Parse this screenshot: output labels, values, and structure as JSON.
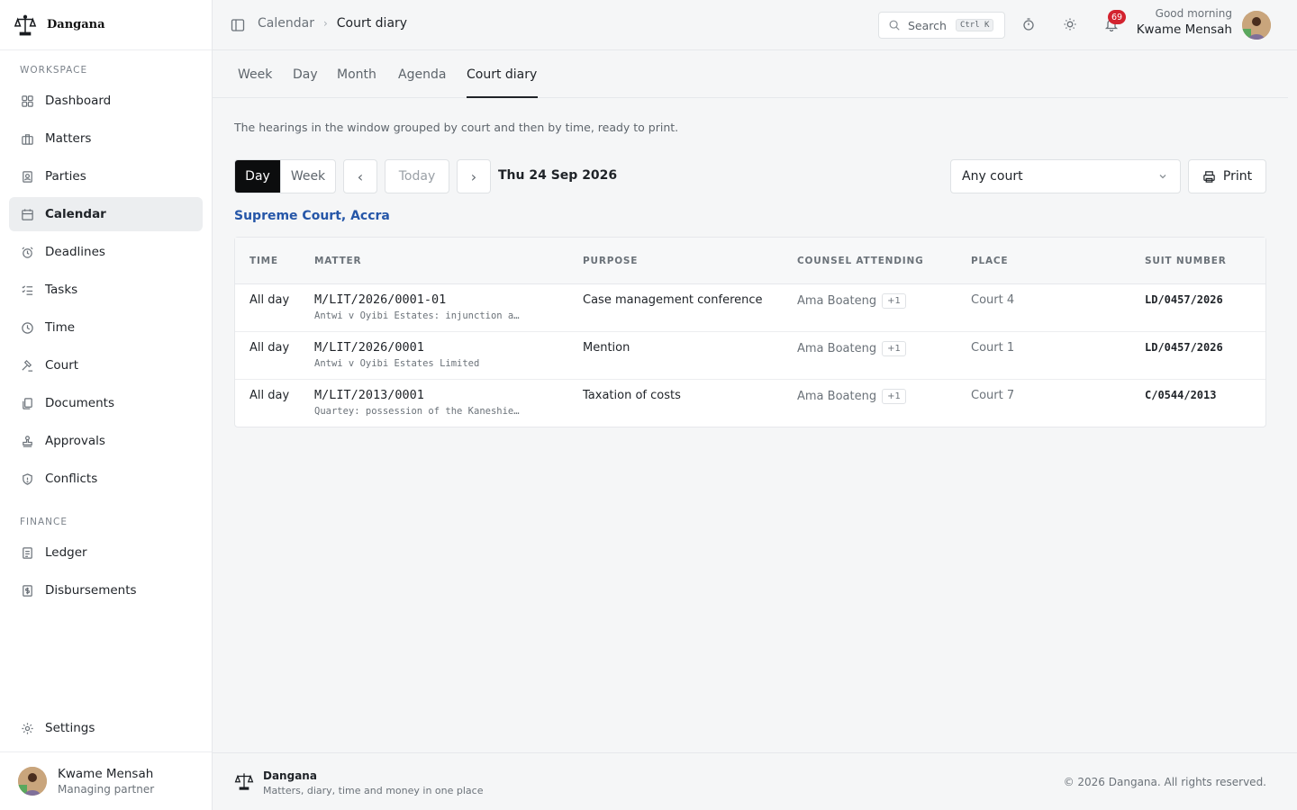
{
  "app": {
    "name": "Dangana",
    "tagline": "Matters, diary, time and money in one place",
    "copyright": "© 2026 Dangana. All rights reserved."
  },
  "sidebar": {
    "sections": [
      {
        "label": "WORKSPACE"
      },
      {
        "label": "FINANCE"
      }
    ],
    "items": [
      {
        "label": "Dashboard",
        "icon": "dashboard-icon"
      },
      {
        "label": "Matters",
        "icon": "briefcase-icon"
      },
      {
        "label": "Parties",
        "icon": "contact-card-icon"
      },
      {
        "label": "Calendar",
        "icon": "calendar-icon"
      },
      {
        "label": "Deadlines",
        "icon": "alarm-clock-icon"
      },
      {
        "label": "Tasks",
        "icon": "task-list-icon"
      },
      {
        "label": "Time",
        "icon": "clock-icon"
      },
      {
        "label": "Court",
        "icon": "gavel-icon"
      },
      {
        "label": "Documents",
        "icon": "documents-icon"
      },
      {
        "label": "Approvals",
        "icon": "stamp-icon"
      },
      {
        "label": "Conflicts",
        "icon": "shield-icon"
      },
      {
        "label": "Ledger",
        "icon": "ledger-icon"
      },
      {
        "label": "Disbursements",
        "icon": "receipt-icon"
      }
    ],
    "settings_label": "Settings",
    "active": "Calendar",
    "user": {
      "name": "Kwame Mensah",
      "role": "Managing partner"
    }
  },
  "topbar": {
    "breadcrumb": [
      "Calendar",
      "Court diary"
    ],
    "search_label": "Search",
    "search_kbd": "Ctrl K",
    "notifications": "69",
    "greeting": "Good morning",
    "user_name": "Kwame Mensah"
  },
  "tabs": [
    "Week",
    "Day",
    "Month",
    "Agenda",
    "Court diary"
  ],
  "active_tab": "Court diary",
  "description": "The hearings in the window grouped by court and then by time, ready to print.",
  "controls": {
    "range": [
      "Day",
      "Week"
    ],
    "active_range": "Day",
    "prev": "‹",
    "today": "Today",
    "next": "›",
    "date": "Thu 24 Sep 2026",
    "court_select": "Any court",
    "print": "Print"
  },
  "court_group": "Supreme Court, Accra",
  "table": {
    "headers": [
      "TIME",
      "MATTER",
      "PURPOSE",
      "COUNSEL ATTENDING",
      "PLACE",
      "SUIT NUMBER"
    ],
    "rows": [
      {
        "time": "All day",
        "code": "M/LIT/2026/0001-01",
        "sub": "Antwi v Oyibi Estates: injunction a…",
        "purpose": "Case management conference",
        "counsel": "Ama Boateng",
        "extra": "+1",
        "place": "Court 4",
        "suit": "LD/0457/2026"
      },
      {
        "time": "All day",
        "code": "M/LIT/2026/0001",
        "sub": "Antwi v Oyibi Estates Limited",
        "purpose": "Mention",
        "counsel": "Ama Boateng",
        "extra": "+1",
        "place": "Court 1",
        "suit": "LD/0457/2026"
      },
      {
        "time": "All day",
        "code": "M/LIT/2013/0001",
        "sub": "Quartey: possession of the Kaneshie…",
        "purpose": "Taxation of costs",
        "counsel": "Ama Boateng",
        "extra": "+1",
        "place": "Court 7",
        "suit": "C/0544/2013"
      }
    ]
  },
  "colors": {
    "accent": "#2556a8",
    "badge": "#d3232f",
    "active_segment": "#0c0d0e"
  }
}
